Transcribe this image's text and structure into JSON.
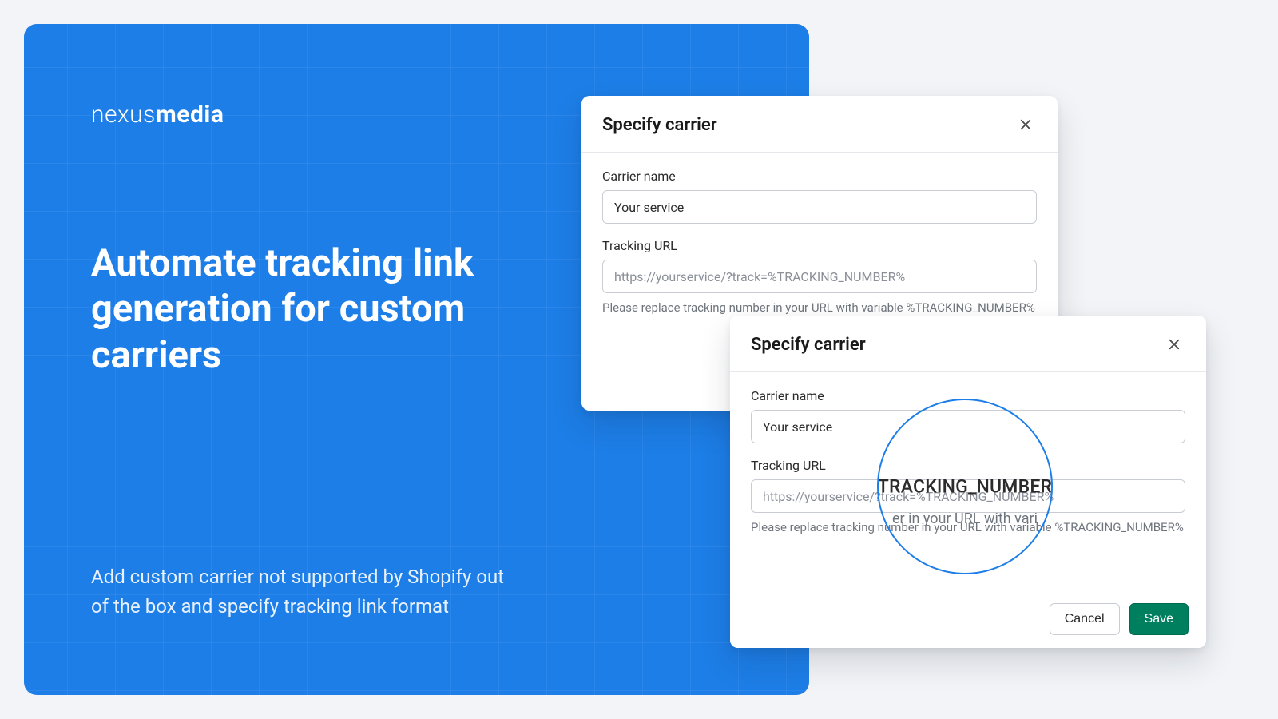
{
  "brand": {
    "light": "nexus",
    "bold": "media"
  },
  "hero": {
    "headline": "Automate tracking link generation for custom carriers",
    "subcopy": "Add custom carrier not supported by Shopify out of the box and specify tracking link format"
  },
  "modal": {
    "title": "Specify carrier",
    "carrier_name_label": "Carrier name",
    "carrier_name_value": "Your service",
    "tracking_url_label": "Tracking URL",
    "tracking_url_placeholder": "https://yourservice/?track=%TRACKING_NUMBER%",
    "help_text": "Please replace tracking number in your URL with variable %TRACKING_NUMBER%",
    "cancel_label": "Cancel",
    "save_label": "Save"
  },
  "magnifier": {
    "main": "%TRACKING_NUMBER%",
    "sub": "er in your URL with vari"
  },
  "colors": {
    "accent": "#1d7ee7",
    "primary_button": "#007f5f"
  }
}
